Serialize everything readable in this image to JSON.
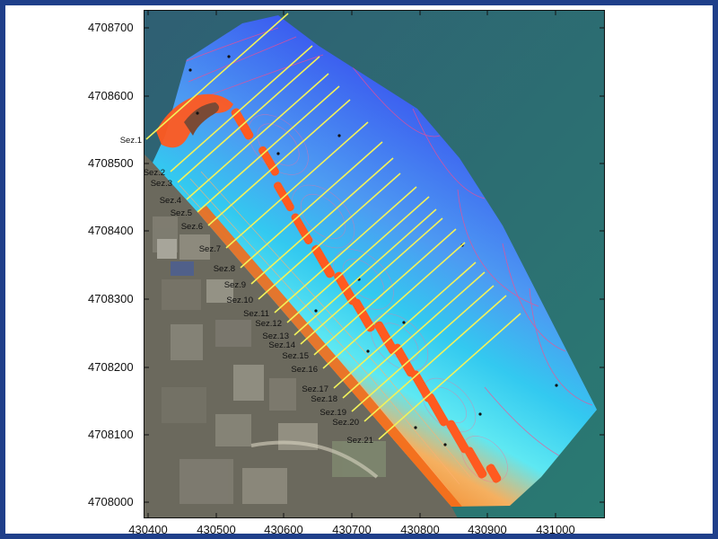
{
  "map": {
    "y_ticks": [
      "4708700",
      "4708600",
      "4708500",
      "4708400",
      "4708300",
      "4708200",
      "4708100",
      "4708000"
    ],
    "x_ticks": [
      "430400",
      "430500",
      "430600",
      "430700",
      "430800",
      "430900",
      "431000"
    ],
    "sections": [
      "Sez.1",
      "Sez.2",
      "Sez.3",
      "Sez.4",
      "Sez.5",
      "Sez.6",
      "Sez.7",
      "Sez.8",
      "Sez.9",
      "Sez.10",
      "Sez.11",
      "Sez.12",
      "Sez.13",
      "Sez.14",
      "Sez.15",
      "Sez.16",
      "Sez.17",
      "Sez.18",
      "Sez.19",
      "Sez.20",
      "Sez.21"
    ],
    "colors": {
      "sea": "#2f6e73",
      "land": "#6d6a5e",
      "deep": "#3a5cf0",
      "mid": "#4aa0f0",
      "shallow": "#31d7ee",
      "shore": "#f2871f",
      "contour_line": "#ff4a8a",
      "section_line": "#f2f25a",
      "breakwater": "#ff5a20"
    }
  }
}
